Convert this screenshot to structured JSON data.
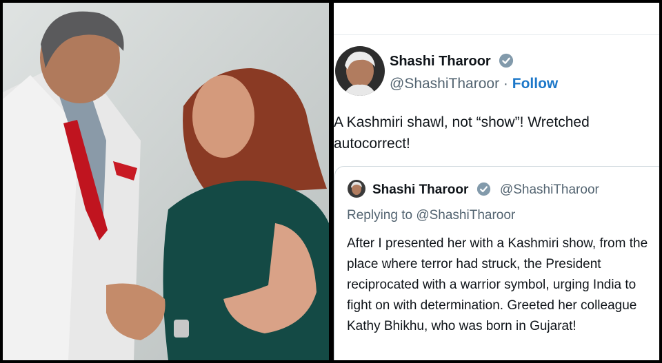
{
  "tweet": {
    "author_name": "Shashi Tharoor",
    "author_handle": "@ShashiTharoor",
    "separator": "·",
    "follow_label": "Follow",
    "text": "A Kashmiri shawl, not “show”! Wretched autocorrect!"
  },
  "quoted_tweet": {
    "author_name": "Shashi Tharoor",
    "author_handle": "@ShashiTharoor",
    "replying_to": "Replying to @ShashiTharoor",
    "text": "After I presented her with a Kashmiri show, from the place where terror had struck, the President reciprocated with a warrior symbol, urging India to fight on with determination. Greeted her colleague Kathy Bhikhu, who was born in Gujarat!"
  },
  "colors": {
    "follow_blue": "#1d78c9",
    "handle_gray": "#536471",
    "verified_badge": "#829aab"
  },
  "icons": {
    "verified": "verified-badge-icon"
  }
}
